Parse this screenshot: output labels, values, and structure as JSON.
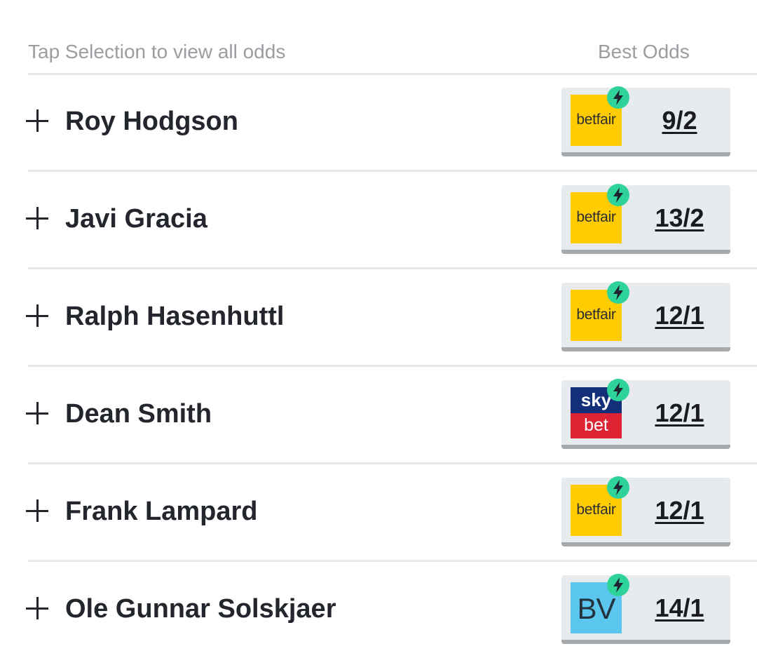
{
  "header": {
    "instruction": "Tap Selection to view all odds",
    "best_odds_label": "Best Odds"
  },
  "colors": {
    "accent_bolt": "#2ed39a",
    "betfair_yellow": "#ffcc00",
    "skybet_blue": "#142f7a",
    "skybet_red": "#de2334",
    "bv_blue": "#5bc6ee"
  },
  "selections": [
    {
      "name": "Roy Hodgson",
      "bookmaker": "betfair",
      "logo_text": "betfair",
      "odds": "9/2"
    },
    {
      "name": "Javi Gracia",
      "bookmaker": "betfair",
      "logo_text": "betfair",
      "odds": "13/2"
    },
    {
      "name": "Ralph Hasenhuttl",
      "bookmaker": "betfair",
      "logo_text": "betfair",
      "odds": "12/1"
    },
    {
      "name": "Dean Smith",
      "bookmaker": "skybet",
      "logo_text_top": "sky",
      "logo_text_bottom": "bet",
      "odds": "12/1"
    },
    {
      "name": "Frank Lampard",
      "bookmaker": "betfair",
      "logo_text": "betfair",
      "odds": "12/1"
    },
    {
      "name": "Ole Gunnar Solskjaer",
      "bookmaker": "bv",
      "logo_text": "BV",
      "odds": "14/1"
    }
  ]
}
